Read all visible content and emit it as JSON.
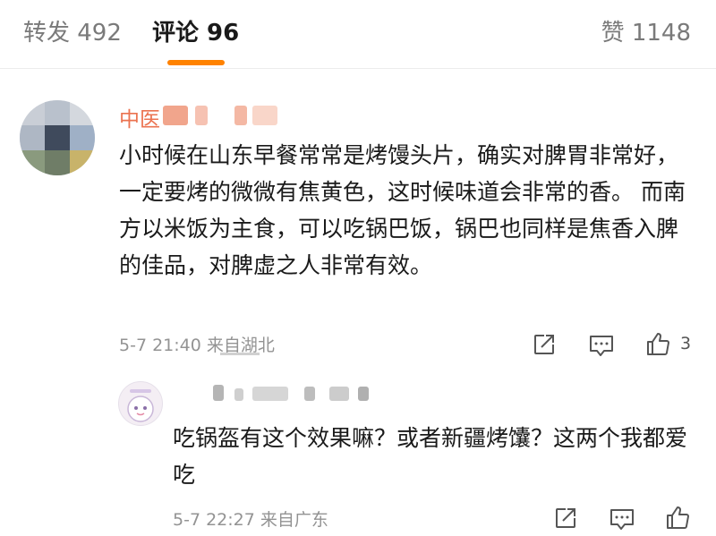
{
  "tabs": {
    "repost": "转发 492",
    "comment": "评论 96",
    "like": "赞 1148"
  },
  "comment": {
    "username": "中医",
    "text": "小时候在山东早餐常常是烤馒头片，确实对脾胃非常好，一定要烤的微微有焦黄色，这时候味道会非常的香。 而南方以米饭为主食，可以吃锅巴饭，锅巴也同样是焦香入脾的佳品，对脾虚之人非常有效。",
    "meta": "5-7 21:40  来自湖北",
    "like_count": "3"
  },
  "reply": {
    "text": "吃锅盔有这个效果嘛？或者新疆烤馕？这两个我都爱吃",
    "meta": "5-7 22:27  来自广东"
  },
  "colors": {
    "accent": "#ff8200",
    "username": "#eb7350",
    "secondary_text": "#939393"
  },
  "icons": [
    "share-icon",
    "reply-comment-icon",
    "thumbs-up-icon"
  ]
}
